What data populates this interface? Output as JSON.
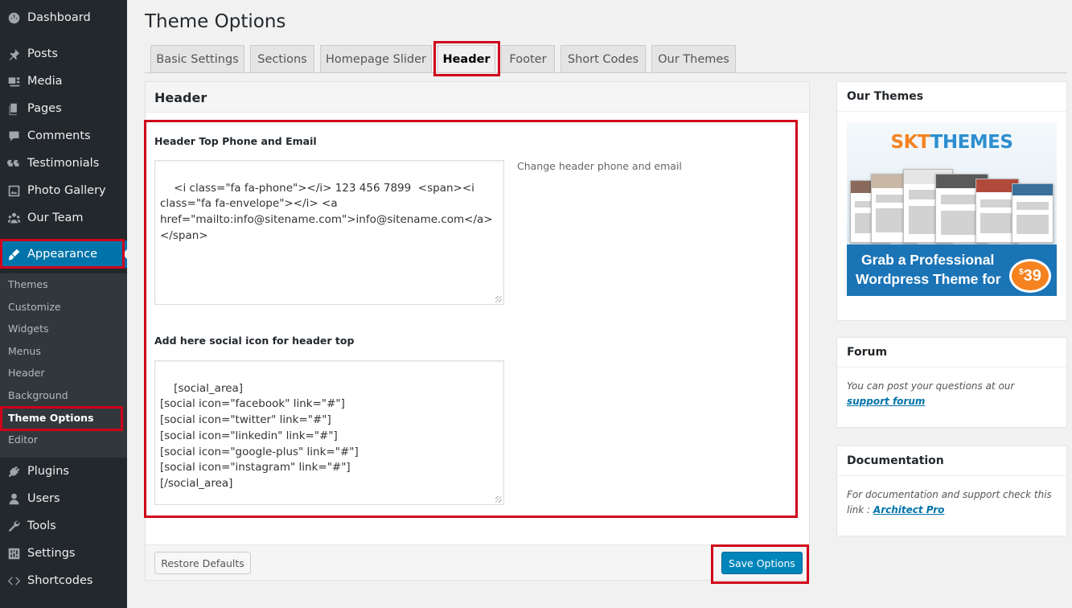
{
  "sidebar": {
    "items": [
      {
        "label": "Dashboard",
        "icon": "dashboard-icon"
      },
      {
        "label": "Posts",
        "icon": "pin-icon"
      },
      {
        "label": "Media",
        "icon": "media-icon"
      },
      {
        "label": "Pages",
        "icon": "pages-icon"
      },
      {
        "label": "Comments",
        "icon": "comment-icon"
      },
      {
        "label": "Testimonials",
        "icon": "quote-icon"
      },
      {
        "label": "Photo Gallery",
        "icon": "gallery-icon"
      },
      {
        "label": "Our Team",
        "icon": "team-icon"
      },
      {
        "label": "Appearance",
        "icon": "paintbrush-icon"
      },
      {
        "label": "Plugins",
        "icon": "plugin-icon"
      },
      {
        "label": "Users",
        "icon": "user-icon"
      },
      {
        "label": "Tools",
        "icon": "wrench-icon"
      },
      {
        "label": "Settings",
        "icon": "settings-icon"
      },
      {
        "label": "Shortcodes",
        "icon": "code-icon"
      }
    ],
    "submenu": [
      "Themes",
      "Customize",
      "Widgets",
      "Menus",
      "Header",
      "Background",
      "Theme Options",
      "Editor"
    ]
  },
  "page": {
    "title": "Theme Options",
    "tabs": [
      "Basic Settings",
      "Sections",
      "Homepage Slider",
      "Header",
      "Footer",
      "Short Codes",
      "Our Themes"
    ],
    "active_tab": "Header"
  },
  "main": {
    "heading": "Header",
    "fields": [
      {
        "label": "Header Top Phone and Email",
        "value": "<i class=\"fa fa-phone\"></i> 123 456 7899  <span><i class=\"fa fa-envelope\"></i> <a href=\"mailto:info@sitename.com\">info@sitename.com</a> </span>",
        "description": "Change header phone and email"
      },
      {
        "label": "Add here social icon for header top",
        "value": "[social_area]\n[social icon=\"facebook\" link=\"#\"]\n[social icon=\"twitter\" link=\"#\"]\n[social icon=\"linkedin\" link=\"#\"]\n[social icon=\"google-plus\" link=\"#\"]\n[social icon=\"instagram\" link=\"#\"]\n[/social_area]",
        "description": ""
      }
    ],
    "restore_label": "Restore Defaults",
    "save_label": "Save Options"
  },
  "right": {
    "themes": {
      "title": "Our Themes",
      "banner": {
        "logo_part1": "SKT",
        "logo_part2": "THEMES",
        "line1": "Grab a Professional",
        "line2": "Wordpress Theme for",
        "price_currency": "$",
        "price_value": "39"
      }
    },
    "forum": {
      "title": "Forum",
      "text": "You can post your questions at our ",
      "link": "support forum"
    },
    "docs": {
      "title": "Documentation",
      "text": "For documentation and support check this link : ",
      "link": "Architect Pro"
    }
  },
  "colors": {
    "sidebar_bg": "#23282d",
    "submenu_bg": "#32373c",
    "accent": "#0073aa",
    "button_primary": "#0085ba",
    "highlight_box": "#d0021b"
  }
}
